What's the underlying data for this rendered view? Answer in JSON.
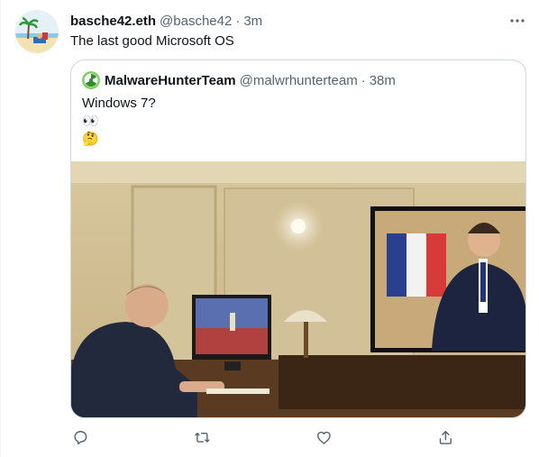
{
  "tweet": {
    "author_name": "basche42.eth",
    "author_handle": "@basche42",
    "time": "3m",
    "text": "The last good Microsoft OS"
  },
  "quoted": {
    "author_name": "MalwareHunterTeam",
    "author_handle": "@malwrhunterteam",
    "time": "38m",
    "text": "Windows 7?",
    "emoji_line_1": "👀",
    "emoji_line_2": "🤔",
    "image_icon": "photo-meeting-video-call"
  },
  "actions": {
    "reply_icon": "reply-icon",
    "retweet_icon": "retweet-icon",
    "like_icon": "like-icon",
    "share_icon": "share-icon"
  },
  "colors": {
    "text": "#0f1419",
    "secondary": "#536471",
    "border": "#cfd9de",
    "divider": "#eff3f4"
  }
}
